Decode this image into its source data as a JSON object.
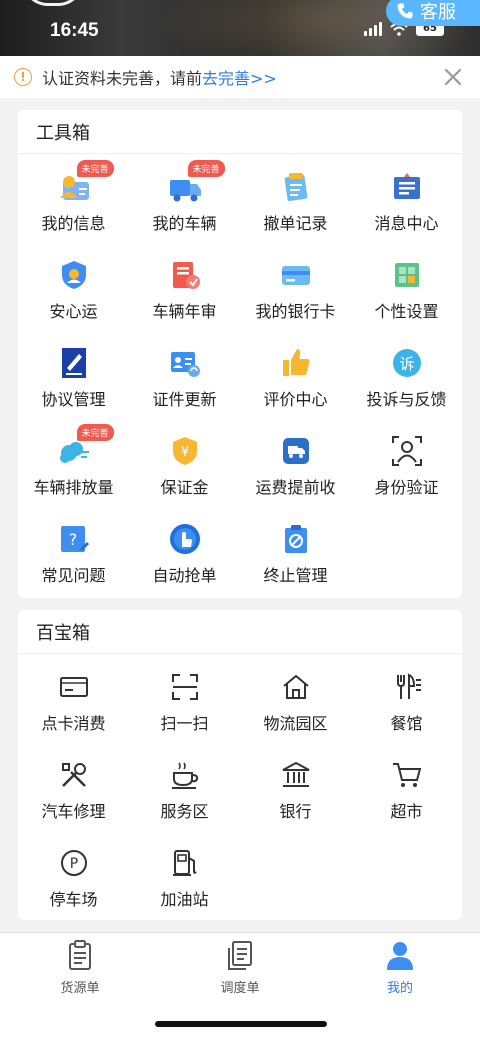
{
  "status_bar": {
    "time": "16:45",
    "battery": "65"
  },
  "header": {
    "service_label": "客服"
  },
  "notice": {
    "text": "认证资料未完善，请前",
    "link": "去完善>>",
    "icon": "warning-icon"
  },
  "toolbox": {
    "title": "工具箱",
    "items": [
      {
        "label": "我的信息",
        "badge": "未完善",
        "icon": "user-card-icon"
      },
      {
        "label": "我的车辆",
        "badge": "未完善",
        "icon": "truck-icon"
      },
      {
        "label": "撤单记录",
        "badge": "",
        "icon": "record-icon"
      },
      {
        "label": "消息中心",
        "badge": "",
        "icon": "message-icon"
      },
      {
        "label": "安心运",
        "badge": "",
        "icon": "shield-icon"
      },
      {
        "label": "车辆年审",
        "badge": "",
        "icon": "inspection-icon"
      },
      {
        "label": "我的银行卡",
        "badge": "",
        "icon": "bank-card-icon"
      },
      {
        "label": "个性设置",
        "badge": "",
        "icon": "settings-icon"
      },
      {
        "label": "协议管理",
        "badge": "",
        "icon": "agreement-icon"
      },
      {
        "label": "证件更新",
        "badge": "",
        "icon": "id-update-icon"
      },
      {
        "label": "评价中心",
        "badge": "",
        "icon": "thumbs-up-icon"
      },
      {
        "label": "投诉与反馈",
        "badge": "",
        "icon": "complaint-icon"
      },
      {
        "label": "车辆排放量",
        "badge": "未完善",
        "icon": "emission-icon"
      },
      {
        "label": "保证金",
        "badge": "",
        "icon": "deposit-icon"
      },
      {
        "label": "运费提前收",
        "badge": "",
        "icon": "freight-advance-icon"
      },
      {
        "label": "身份验证",
        "badge": "",
        "icon": "face-verify-icon"
      },
      {
        "label": "常见问题",
        "badge": "",
        "icon": "faq-icon"
      },
      {
        "label": "自动抢单",
        "badge": "",
        "icon": "auto-grab-icon"
      },
      {
        "label": "终止管理",
        "badge": "",
        "icon": "terminate-icon"
      }
    ]
  },
  "treasure": {
    "title": "百宝箱",
    "items": [
      {
        "label": "点卡消费",
        "icon": "card-icon"
      },
      {
        "label": "扫一扫",
        "icon": "scan-icon"
      },
      {
        "label": "物流园区",
        "icon": "home-icon"
      },
      {
        "label": "餐馆",
        "icon": "restaurant-icon"
      },
      {
        "label": "汽车修理",
        "icon": "repair-icon"
      },
      {
        "label": "服务区",
        "icon": "coffee-icon"
      },
      {
        "label": "银行",
        "icon": "bank-icon"
      },
      {
        "label": "超市",
        "icon": "cart-icon"
      },
      {
        "label": "停车场",
        "icon": "parking-icon"
      },
      {
        "label": "加油站",
        "icon": "fuel-icon"
      }
    ]
  },
  "tabs": [
    {
      "label": "货源单",
      "icon": "clipboard-icon",
      "active": false
    },
    {
      "label": "调度单",
      "icon": "documents-icon",
      "active": false
    },
    {
      "label": "我的",
      "icon": "person-icon",
      "active": true
    }
  ],
  "colors": {
    "accent": "#2f7de1",
    "badge": "#f05a4f",
    "service": "#59b6ff"
  }
}
